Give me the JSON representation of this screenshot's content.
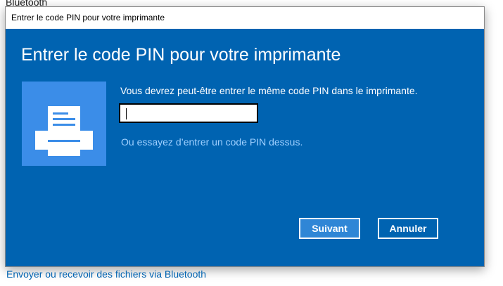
{
  "background": {
    "section_title": "Bluetooth",
    "link_text": "Envoyer ou recevoir des fichiers via Bluetooth"
  },
  "dialog": {
    "window_title": "Entrer le code PIN pour votre imprimante",
    "heading": "Entrer le code PIN pour votre imprimante",
    "icon": "printer-icon",
    "instruction": "Vous devrez peut-être entrer le même code PIN dans le imprimante.",
    "pin_value": "",
    "hint": "Ou essayez d’entrer un code PIN dessus.",
    "next_label": "Suivant",
    "cancel_label": "Annuler"
  },
  "colors": {
    "dialog_background": "#0063b1",
    "icon_tile": "#3b8de8",
    "hint_text": "#9fd0ff",
    "primary_button": "#2f86d6"
  }
}
